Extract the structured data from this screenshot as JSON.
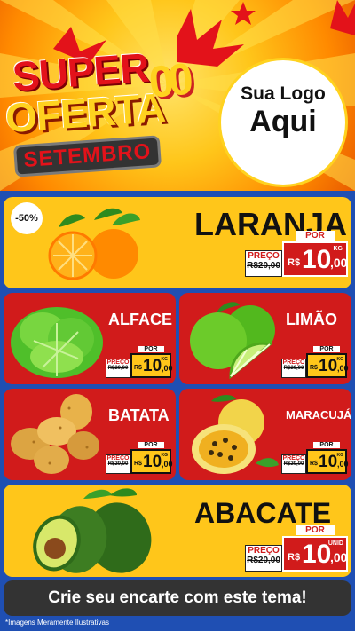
{
  "header": {
    "title_super": "SUPER",
    "title_oferta": "OFERTA",
    "title_zeros": "00",
    "month": "SETEMBRO",
    "logo_line1": "Sua Logo",
    "logo_line2": "Aqui"
  },
  "products": {
    "laranja": {
      "name": "LARANJA",
      "discount": "-50%",
      "price_label": "PREÇO",
      "old_price": "R$20,00",
      "por": "POR",
      "currency": "R$",
      "price_int": "10",
      "price_dec": ",00",
      "unit": "KG"
    },
    "alface": {
      "name": "ALFACE",
      "price_label": "PREÇO",
      "old_price": "R$20,00",
      "por": "POR",
      "currency": "R$",
      "price_int": "10",
      "price_dec": ",00",
      "unit": "KG"
    },
    "limao": {
      "name": "LIMÃO",
      "price_label": "PREÇO",
      "old_price": "R$20,00",
      "por": "POR",
      "currency": "R$",
      "price_int": "10",
      "price_dec": ",00",
      "unit": "KG"
    },
    "batata": {
      "name": "BATATA",
      "price_label": "PREÇO",
      "old_price": "R$20,00",
      "por": "POR",
      "currency": "R$",
      "price_int": "10",
      "price_dec": ",00",
      "unit": "KG"
    },
    "maracuja": {
      "name": "MARACUJÁ",
      "price_label": "PREÇO",
      "old_price": "R$20,00",
      "por": "POR",
      "currency": "R$",
      "price_int": "10",
      "price_dec": ",00",
      "unit": "KG"
    },
    "abacate": {
      "name": "ABACATE",
      "price_label": "PREÇO",
      "old_price": "R$20,00",
      "por": "POR",
      "currency": "R$",
      "price_int": "10",
      "price_dec": ",00",
      "unit": "UNID"
    }
  },
  "cta": "Crie seu encarte com este tema!",
  "footnote": "*Imagens Meramente Ilustrativas",
  "colors": {
    "yellow": "#ffc61a",
    "red": "#d11b1b",
    "blue": "#1f4fb3",
    "dark": "#333333"
  }
}
